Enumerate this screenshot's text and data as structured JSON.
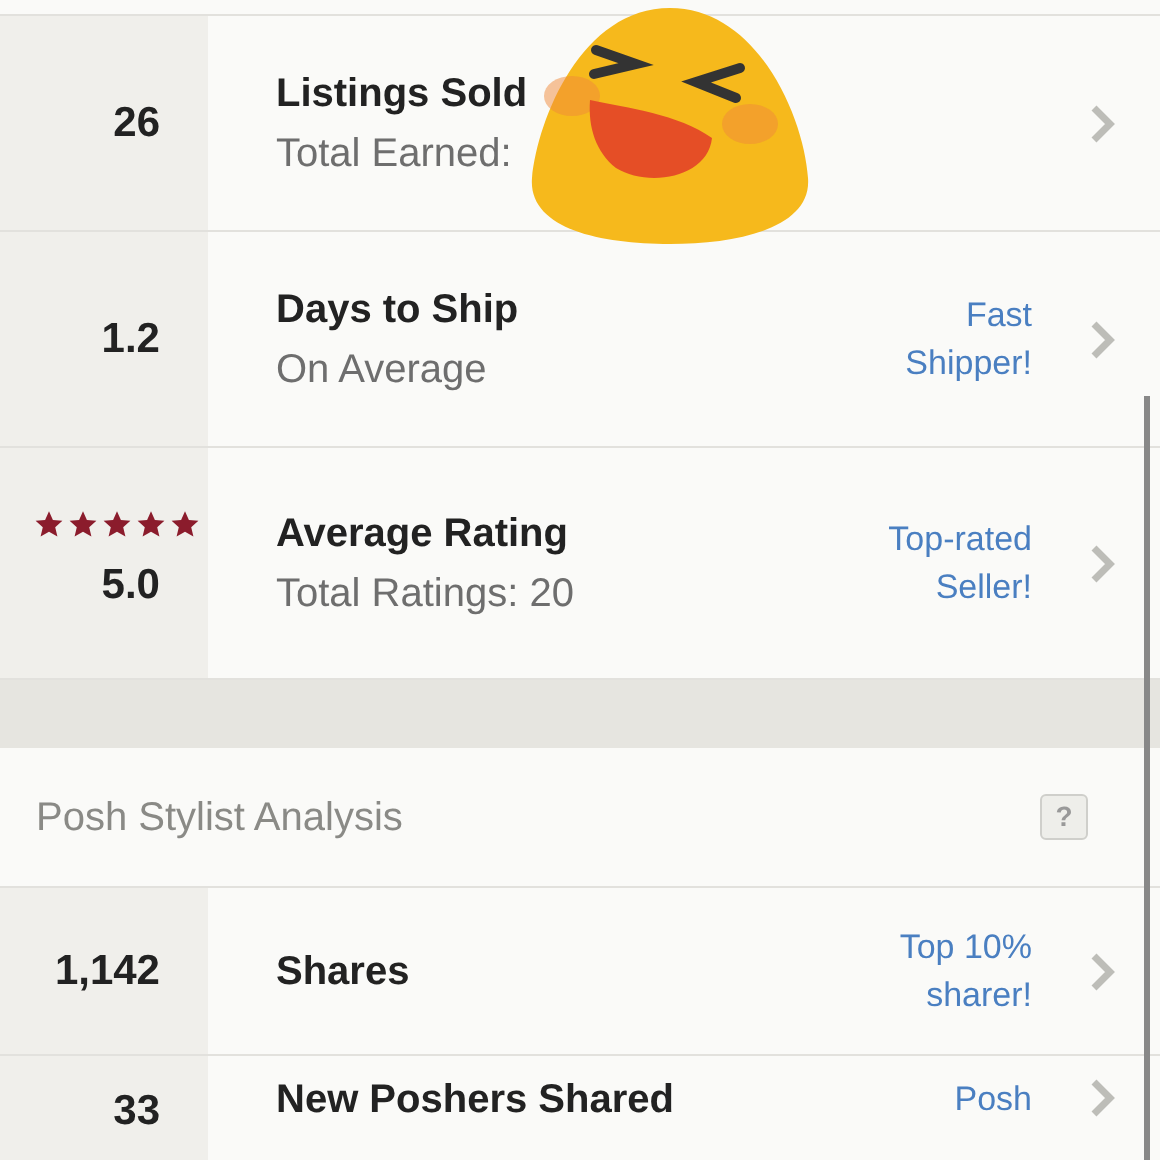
{
  "seller_stats": [
    {
      "value": "26",
      "title": "Listings Sold",
      "subtitle": "Total Earned:"
    },
    {
      "value": "1.2",
      "title": "Days to Ship",
      "subtitle": "On Average",
      "badge": "Fast Shipper!"
    },
    {
      "value": "5.0",
      "stars": 5,
      "title": "Average Rating",
      "subtitle": "Total Ratings: 20",
      "badge": "Top-rated Seller!"
    }
  ],
  "section": {
    "title": "Posh Stylist Analysis",
    "help": "?"
  },
  "stylist_stats": [
    {
      "value": "1,142",
      "title": "Shares",
      "badge": "Top 10% sharer!"
    },
    {
      "value": "33",
      "title": "New Poshers Shared",
      "badge": "Posh"
    }
  ]
}
